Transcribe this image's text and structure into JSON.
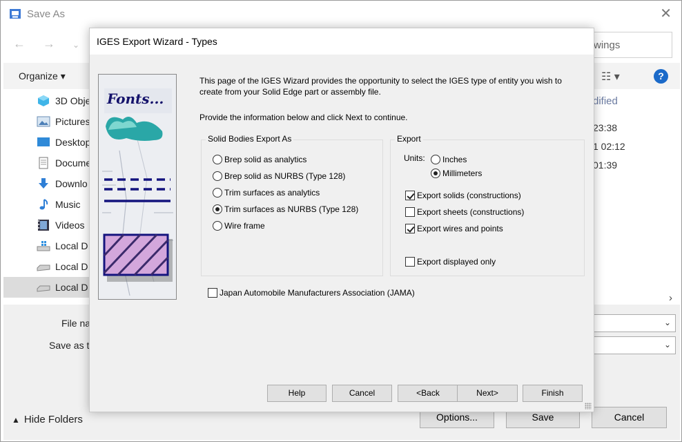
{
  "saveas": {
    "title": "Save As",
    "search_placeholder": "wings",
    "organize_label": "Organize ▾",
    "help_glyph": "?",
    "nav_items": [
      {
        "label": "3D Obje",
        "icon": "3d-objects-icon"
      },
      {
        "label": "Pictures",
        "icon": "pictures-icon"
      },
      {
        "label": "Desktop",
        "icon": "desktop-icon"
      },
      {
        "label": "Docume",
        "icon": "documents-icon"
      },
      {
        "label": "Downlo",
        "icon": "downloads-icon"
      },
      {
        "label": "Music",
        "icon": "music-icon"
      },
      {
        "label": "Videos",
        "icon": "videos-icon"
      },
      {
        "label": "Local D",
        "icon": "windows-drive-icon"
      },
      {
        "label": "Local D",
        "icon": "drive-icon"
      },
      {
        "label": "Local D",
        "icon": "drive-icon",
        "selected": true
      }
    ],
    "details": {
      "column_header": "dified",
      "times": [
        "23:38",
        "1 02:12",
        "01:39"
      ]
    },
    "file_name_label": "File na",
    "save_as_type_label": "Save as ty",
    "hide_folders_label": "Hide Folders",
    "buttons": {
      "options": "Options...",
      "save": "Save",
      "cancel": "Cancel"
    }
  },
  "wizard": {
    "title": "IGES Export Wizard - Types",
    "image_title": "Fonts...",
    "intro": "This page of the IGES Wizard provides the opportunity to select the IGES type of entity you wish to create from your Solid Edge part or assembly file.",
    "intro2": "Provide the information below and click Next to continue.",
    "solid_group": {
      "label": "Solid Bodies Export As",
      "options": [
        {
          "label": "Brep solid as analytics",
          "selected": false
        },
        {
          "label": "Brep solid as NURBS (Type 128)",
          "selected": false
        },
        {
          "label": "Trim surfaces as analytics",
          "selected": false
        },
        {
          "label": "Trim surfaces as NURBS (Type 128)",
          "selected": true
        },
        {
          "label": "Wire frame",
          "selected": false
        }
      ]
    },
    "export_group": {
      "label": "Export",
      "units_label": "Units:",
      "units": [
        {
          "label": "Inches",
          "selected": false
        },
        {
          "label": "Millimeters",
          "selected": true
        }
      ],
      "checks": [
        {
          "label": "Export solids (constructions)",
          "checked": true
        },
        {
          "label": "Export sheets (constructions)",
          "checked": false
        },
        {
          "label": "Export wires and points",
          "checked": true
        }
      ],
      "displayed_only": {
        "label": "Export displayed only",
        "checked": false
      }
    },
    "jama": {
      "label": "Japan Automobile Manufacturers Association (JAMA)",
      "checked": false
    },
    "buttons": {
      "help": "Help",
      "cancel": "Cancel",
      "back": "<Back",
      "next": "Next>",
      "finish": "Finish"
    }
  }
}
